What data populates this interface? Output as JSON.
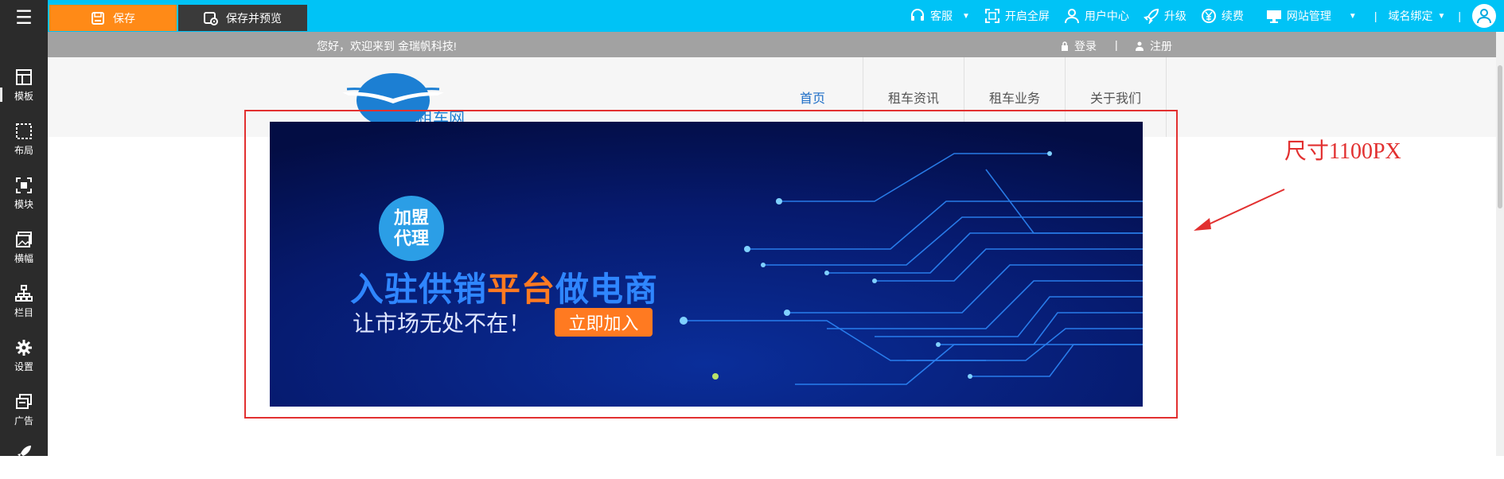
{
  "editor": {
    "menu_icon": "hamburger-menu-icon",
    "sidebar_items": [
      {
        "label": "模板",
        "icon": "template-icon"
      },
      {
        "label": "布局",
        "icon": "layout-icon"
      },
      {
        "label": "模块",
        "icon": "module-icon"
      },
      {
        "label": "横幅",
        "icon": "banner-icon"
      },
      {
        "label": "栏目",
        "icon": "sitemap-icon"
      },
      {
        "label": "设置",
        "icon": "gear-icon"
      },
      {
        "label": "广告",
        "icon": "ad-icon"
      },
      {
        "label": "",
        "icon": "rocket-icon"
      }
    ],
    "toolbar": {
      "save_label": "保存",
      "save_preview_label": "保存并预览",
      "service_label": "客服",
      "fullscreen_label": "开启全屏",
      "user_center_label": "用户中心",
      "upgrade_label": "升级",
      "renew_label": "续费",
      "site_manage_label": "网站管理",
      "domain_bind_label": "域名绑定",
      "separator": "|"
    }
  },
  "site": {
    "welcome_text": "您好，欢迎来到 金瑞帆科技!",
    "login_label": "登录",
    "divider": "|",
    "register_label": "注册",
    "logo_text": "租车网",
    "nav": [
      "首页",
      "租车资讯",
      "租车业务",
      "关于我们"
    ],
    "banner": {
      "badge_line1": "加盟",
      "badge_line2": "代理",
      "headline_part1": "入驻供销",
      "headline_highlight": "平台",
      "headline_part2": "做电商",
      "subline": "让市场无处不在！",
      "cta_label": "立即加入"
    }
  },
  "annotation": {
    "text": "尺寸1100PX"
  },
  "colors": {
    "toolbar_bg": "#00c3f6",
    "save_bg": "#ff8a17",
    "save_preview_bg": "#3a3a3a",
    "sidebar_bg": "#2b2b2b",
    "info_bar_bg": "#a2a2a2",
    "nav_active": "#1f6fc7",
    "annotation_red": "#e23030",
    "banner_accent": "#ff7a21"
  }
}
